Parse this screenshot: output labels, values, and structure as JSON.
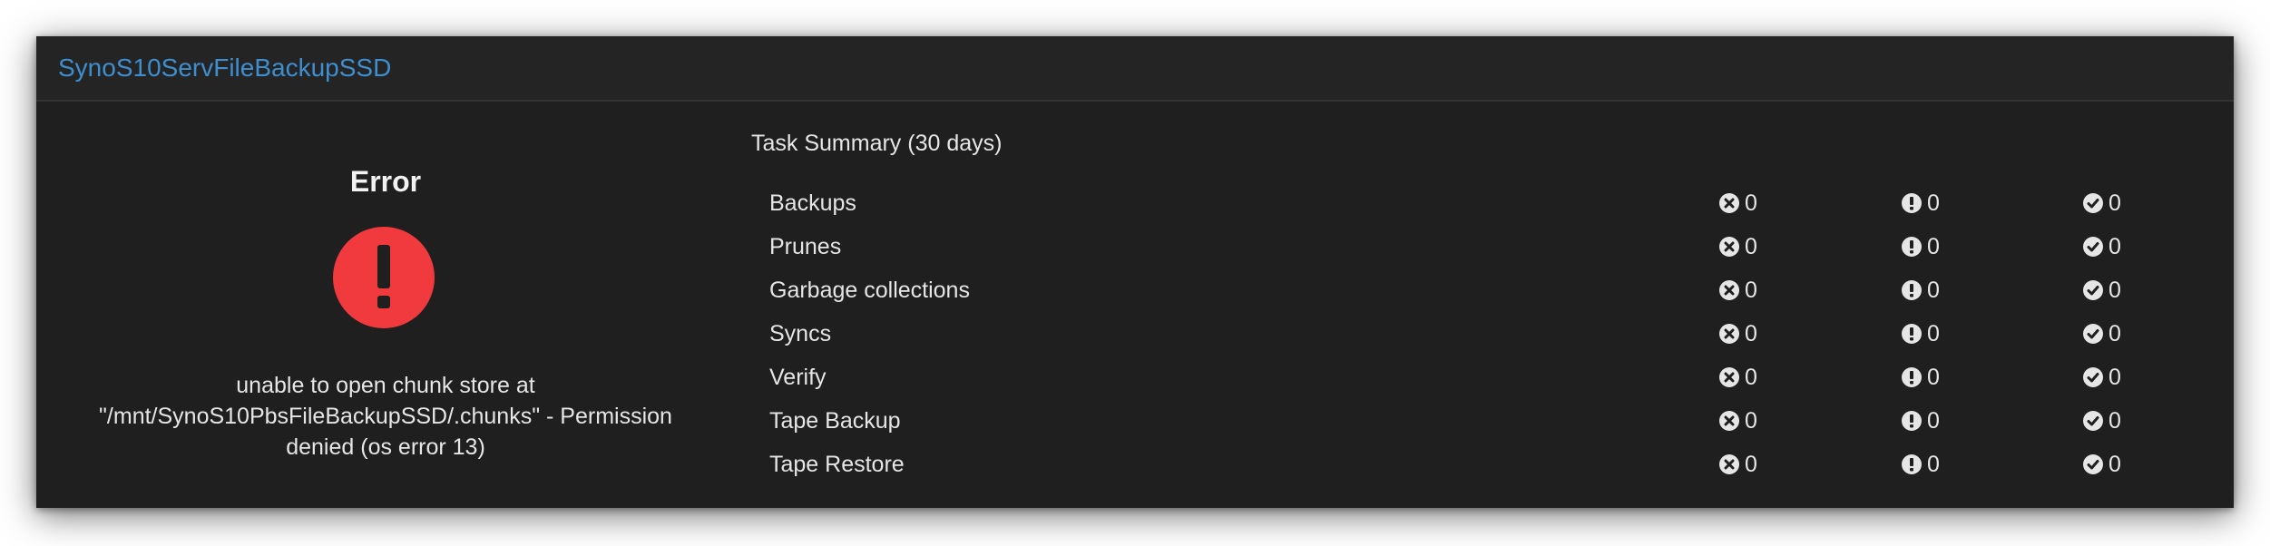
{
  "panel": {
    "title": "SynoS10ServFileBackupSSD"
  },
  "status": {
    "title": "Error",
    "icon": "exclamation-circle-icon",
    "icon_color": "#f03a3e",
    "message": "unable to open chunk store at \"/mnt/SynoS10PbsFileBackupSSD/.chunks\" - Permission denied (os error 13)"
  },
  "summary": {
    "title": "Task Summary (30 days)",
    "rows": [
      {
        "label": "Backups",
        "error": "0",
        "warning": "0",
        "ok": "0"
      },
      {
        "label": "Prunes",
        "error": "0",
        "warning": "0",
        "ok": "0"
      },
      {
        "label": "Garbage collections",
        "error": "0",
        "warning": "0",
        "ok": "0"
      },
      {
        "label": "Syncs",
        "error": "0",
        "warning": "0",
        "ok": "0"
      },
      {
        "label": "Verify",
        "error": "0",
        "warning": "0",
        "ok": "0"
      },
      {
        "label": "Tape Backup",
        "error": "0",
        "warning": "0",
        "ok": "0"
      },
      {
        "label": "Tape Restore",
        "error": "0",
        "warning": "0",
        "ok": "0"
      }
    ]
  },
  "colors": {
    "link": "#3e8ed0",
    "panel_bg": "#1f1f1f",
    "text": "#e6e6e6"
  }
}
